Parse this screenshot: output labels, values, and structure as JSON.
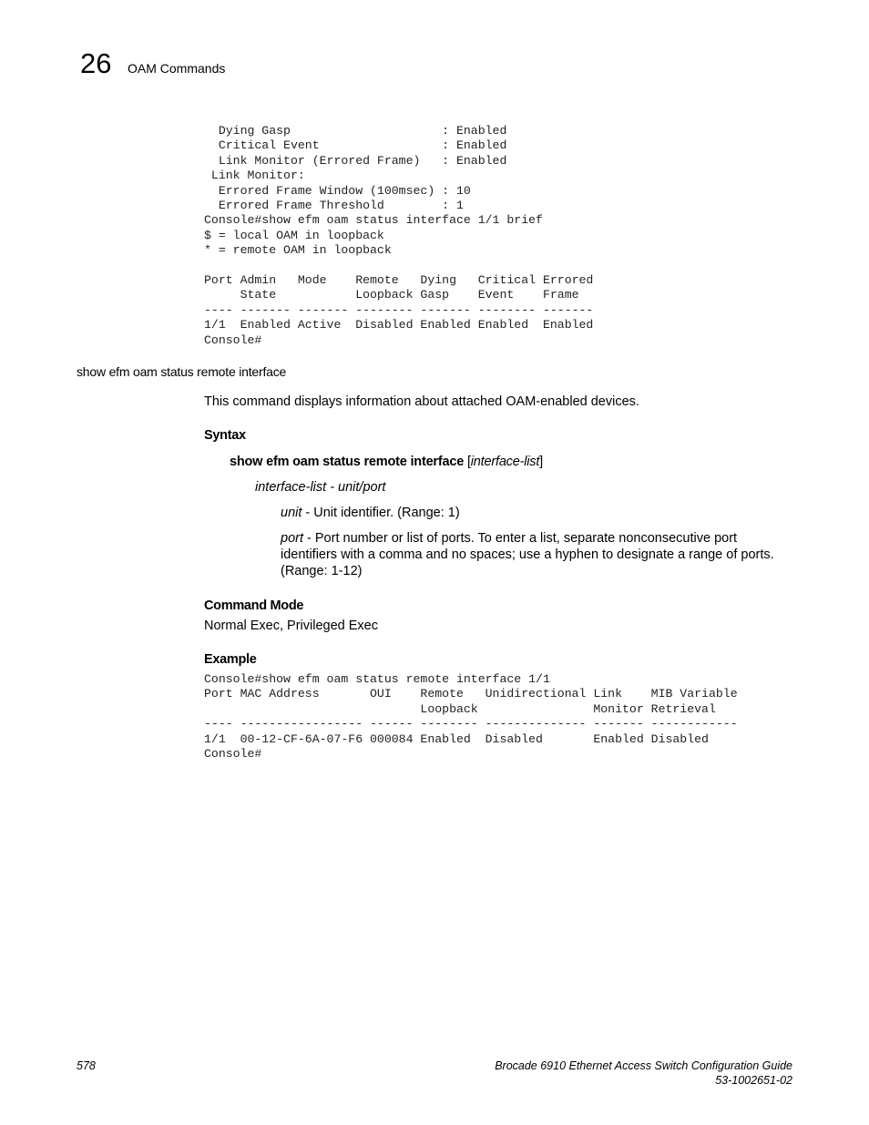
{
  "header": {
    "chapter_number": "26",
    "chapter_title": "OAM Commands"
  },
  "code_top": "  Dying Gasp                     : Enabled\n  Critical Event                 : Enabled\n  Link Monitor (Errored Frame)   : Enabled\n Link Monitor:\n  Errored Frame Window (100msec) : 10\n  Errored Frame Threshold        : 1\nConsole#show efm oam status interface 1/1 brief\n$ = local OAM in loopback\n* = remote OAM in loopback\n\nPort Admin   Mode    Remote   Dying   Critical Errored\n     State           Loopback Gasp    Event    Frame\n---- ------- ------- -------- ------- -------- -------\n1/1  Enabled Active  Disabled Enabled Enabled  Enabled\nConsole#",
  "section": {
    "heading": "show efm oam status remote interface",
    "description": "This command displays information about attached OAM-enabled devices.",
    "syntax_label": "Syntax",
    "syntax_command": "show efm oam status remote interface",
    "syntax_open": " [",
    "syntax_param": "interface-list",
    "syntax_close": "]",
    "param_line": "interface-list - unit/port",
    "unit_term": "unit",
    "unit_desc": " - Unit identifier. (Range: 1)",
    "port_term": "port",
    "port_desc_1": " - Port number or list of ports. To enter a list, separate nonconsecutive port",
    "port_desc_2": "identifiers with a comma and no spaces; use a hyphen to designate a range of ports.",
    "port_desc_3": "(Range: 1-12)",
    "command_mode_label": "Command Mode",
    "command_mode_value": "Normal Exec, Privileged Exec",
    "example_label": "Example"
  },
  "code_example": "Console#show efm oam status remote interface 1/1\nPort MAC Address       OUI    Remote   Unidirectional Link    MIB Variable\n                              Loopback                Monitor Retrieval\n---- ----------------- ------ -------- -------------- ------- ------------\n1/1  00-12-CF-6A-07-F6 000084 Enabled  Disabled       Enabled Disabled\nConsole#",
  "footer": {
    "page_number": "578",
    "doc_title": "Brocade 6910 Ethernet Access Switch Configuration Guide",
    "doc_number": "53-1002651-02"
  }
}
